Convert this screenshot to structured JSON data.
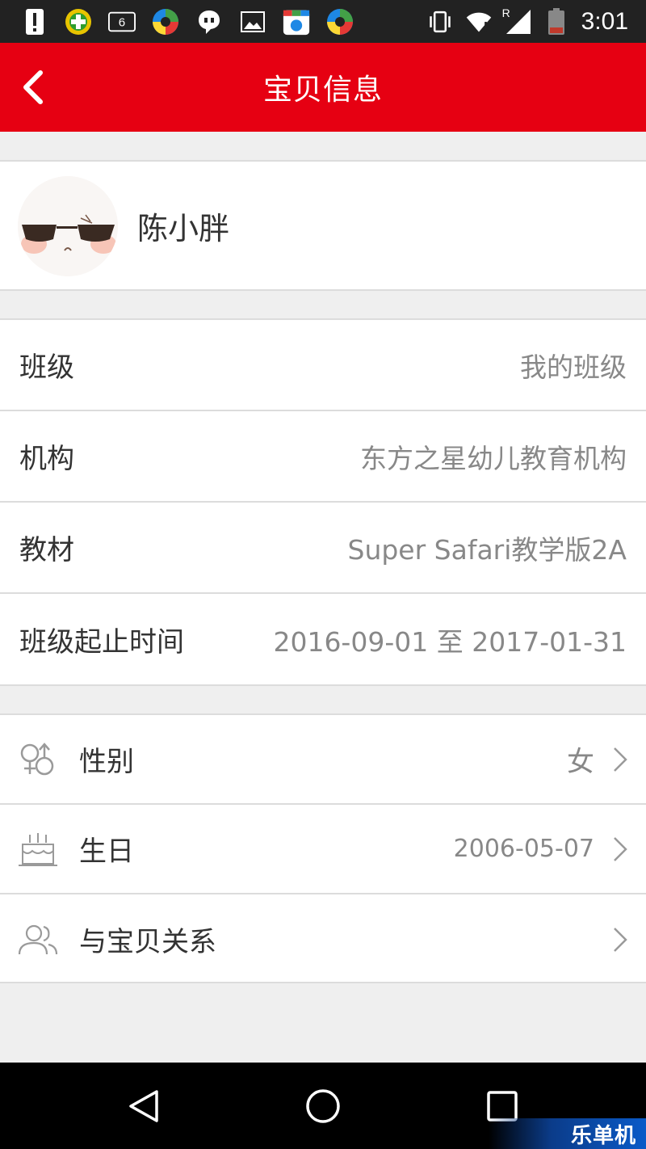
{
  "status_bar": {
    "time": "3:01",
    "notification_badge": "6",
    "signal_label": "R",
    "icons": [
      "alert-icon",
      "add-circle-icon",
      "sim-badge-icon",
      "app-icon",
      "chat-icon",
      "image-icon",
      "calendar-app-icon",
      "app-icon",
      "vibrate-icon",
      "wifi-icon",
      "cell-signal-icon",
      "battery-icon"
    ]
  },
  "app_bar": {
    "title": "宝贝信息",
    "back_icon": "chevron-left-icon"
  },
  "profile": {
    "name": "陈小胖",
    "avatar_icon": "avatar"
  },
  "info_rows": [
    {
      "label": "班级",
      "value": "我的班级"
    },
    {
      "label": "机构",
      "value": "东方之星幼儿教育机构"
    },
    {
      "label": "教材",
      "value": "Super Safari教学版2A"
    },
    {
      "label": "班级起止时间",
      "value": "2016-09-01 至 2017-01-31"
    }
  ],
  "pref_rows": [
    {
      "icon": "gender-icon",
      "label": "性别",
      "value": "女"
    },
    {
      "icon": "birthday-cake-icon",
      "label": "生日",
      "value": "2006-05-07"
    },
    {
      "icon": "people-icon",
      "label": "与宝贝关系",
      "value": ""
    }
  ],
  "nav_bar": {
    "buttons": [
      "back-triangle-icon",
      "home-circle-icon",
      "recents-square-icon"
    ]
  },
  "watermark": "乐单机",
  "colors": {
    "accent": "#e60012",
    "background": "#efefef",
    "divider": "#dcdcdc",
    "text_primary": "#333333",
    "text_secondary": "#888888"
  }
}
